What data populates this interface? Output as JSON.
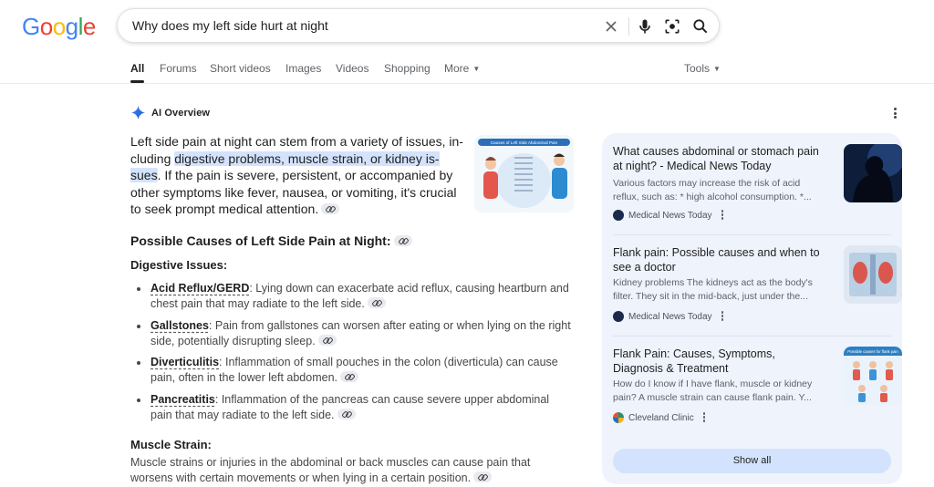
{
  "logo": {
    "letters": [
      "G",
      "o",
      "o",
      "g",
      "l",
      "e"
    ],
    "colors": [
      "#4285F4",
      "#EA4335",
      "#FBBC05",
      "#4285F4",
      "#34A853",
      "#EA4335"
    ]
  },
  "search": {
    "query": "Why does my left side hurt at night"
  },
  "tabs": [
    "All",
    "Forums",
    "Short videos",
    "Images",
    "Videos",
    "Shopping",
    "More",
    "Tools"
  ],
  "ai": {
    "title": "AI Overview",
    "intro_before": "Left side pain at night can stem from a variety of issues, in-cluding ",
    "intro_highlight": "digestive problems, muscle strain, or kidney is-sues",
    "intro_after": ". If the pain is severe, persistent, or accompanied by other symptoms like fever, nausea, or vomiting, it's crucial to seek prompt medical attention.",
    "thumb_caption": "Causes of Left Side Abdominal Pain",
    "section_title": "Possible Causes of Left Side Pain at Night:",
    "digestive_title": "Digestive Issues:",
    "items": [
      {
        "term": "Acid Reflux/GERD",
        "text": ": Lying down can exacerbate acid reflux, causing heartburn and chest pain that may radiate to the left side."
      },
      {
        "term": "Gallstones",
        "text": ": Pain from gallstones can worsen after eating or when lying on the right side, potentially disrupting sleep."
      },
      {
        "term": "Diverticulitis",
        "text": ": Inflammation of small pouches in the colon (diverticula) can cause pain, often in the lower left abdomen."
      },
      {
        "term": "Pancreatitis",
        "text": ": Inflammation of the pancreas can cause severe upper abdominal pain that may radiate to the left side."
      }
    ],
    "muscle_title": "Muscle Strain:",
    "muscle_text": "Muscle strains or injuries in the abdominal or back muscles can cause pain that worsens with certain movements or when lying in a certain position."
  },
  "sources": [
    {
      "title": "What causes abdominal or stomach pain at night? - Medical News Today",
      "snippet": "Various factors may increase the risk of acid reflux, such as: * high alcohol consumption. *...",
      "source": "Medical News Today"
    },
    {
      "title": "Flank pain: Possible causes and when to see a doctor",
      "snippet": "Kidney problems The kidneys act as the body's filter. They sit in the mid-back, just under the...",
      "source": "Medical News Today"
    },
    {
      "title": "Flank Pain: Causes, Symptoms, Diagnosis & Treatment",
      "snippet": "How do I know if I have flank, muscle or kidney pain? A muscle strain can cause flank pain. Y...",
      "source": "Cleveland Clinic",
      "img_caption": "Possible causes for flank pain"
    }
  ],
  "show_all": "Show all",
  "colors": {
    "accent": "#1a73e8",
    "highlight": "#d3e3fd",
    "panel": "#eef3fc"
  }
}
